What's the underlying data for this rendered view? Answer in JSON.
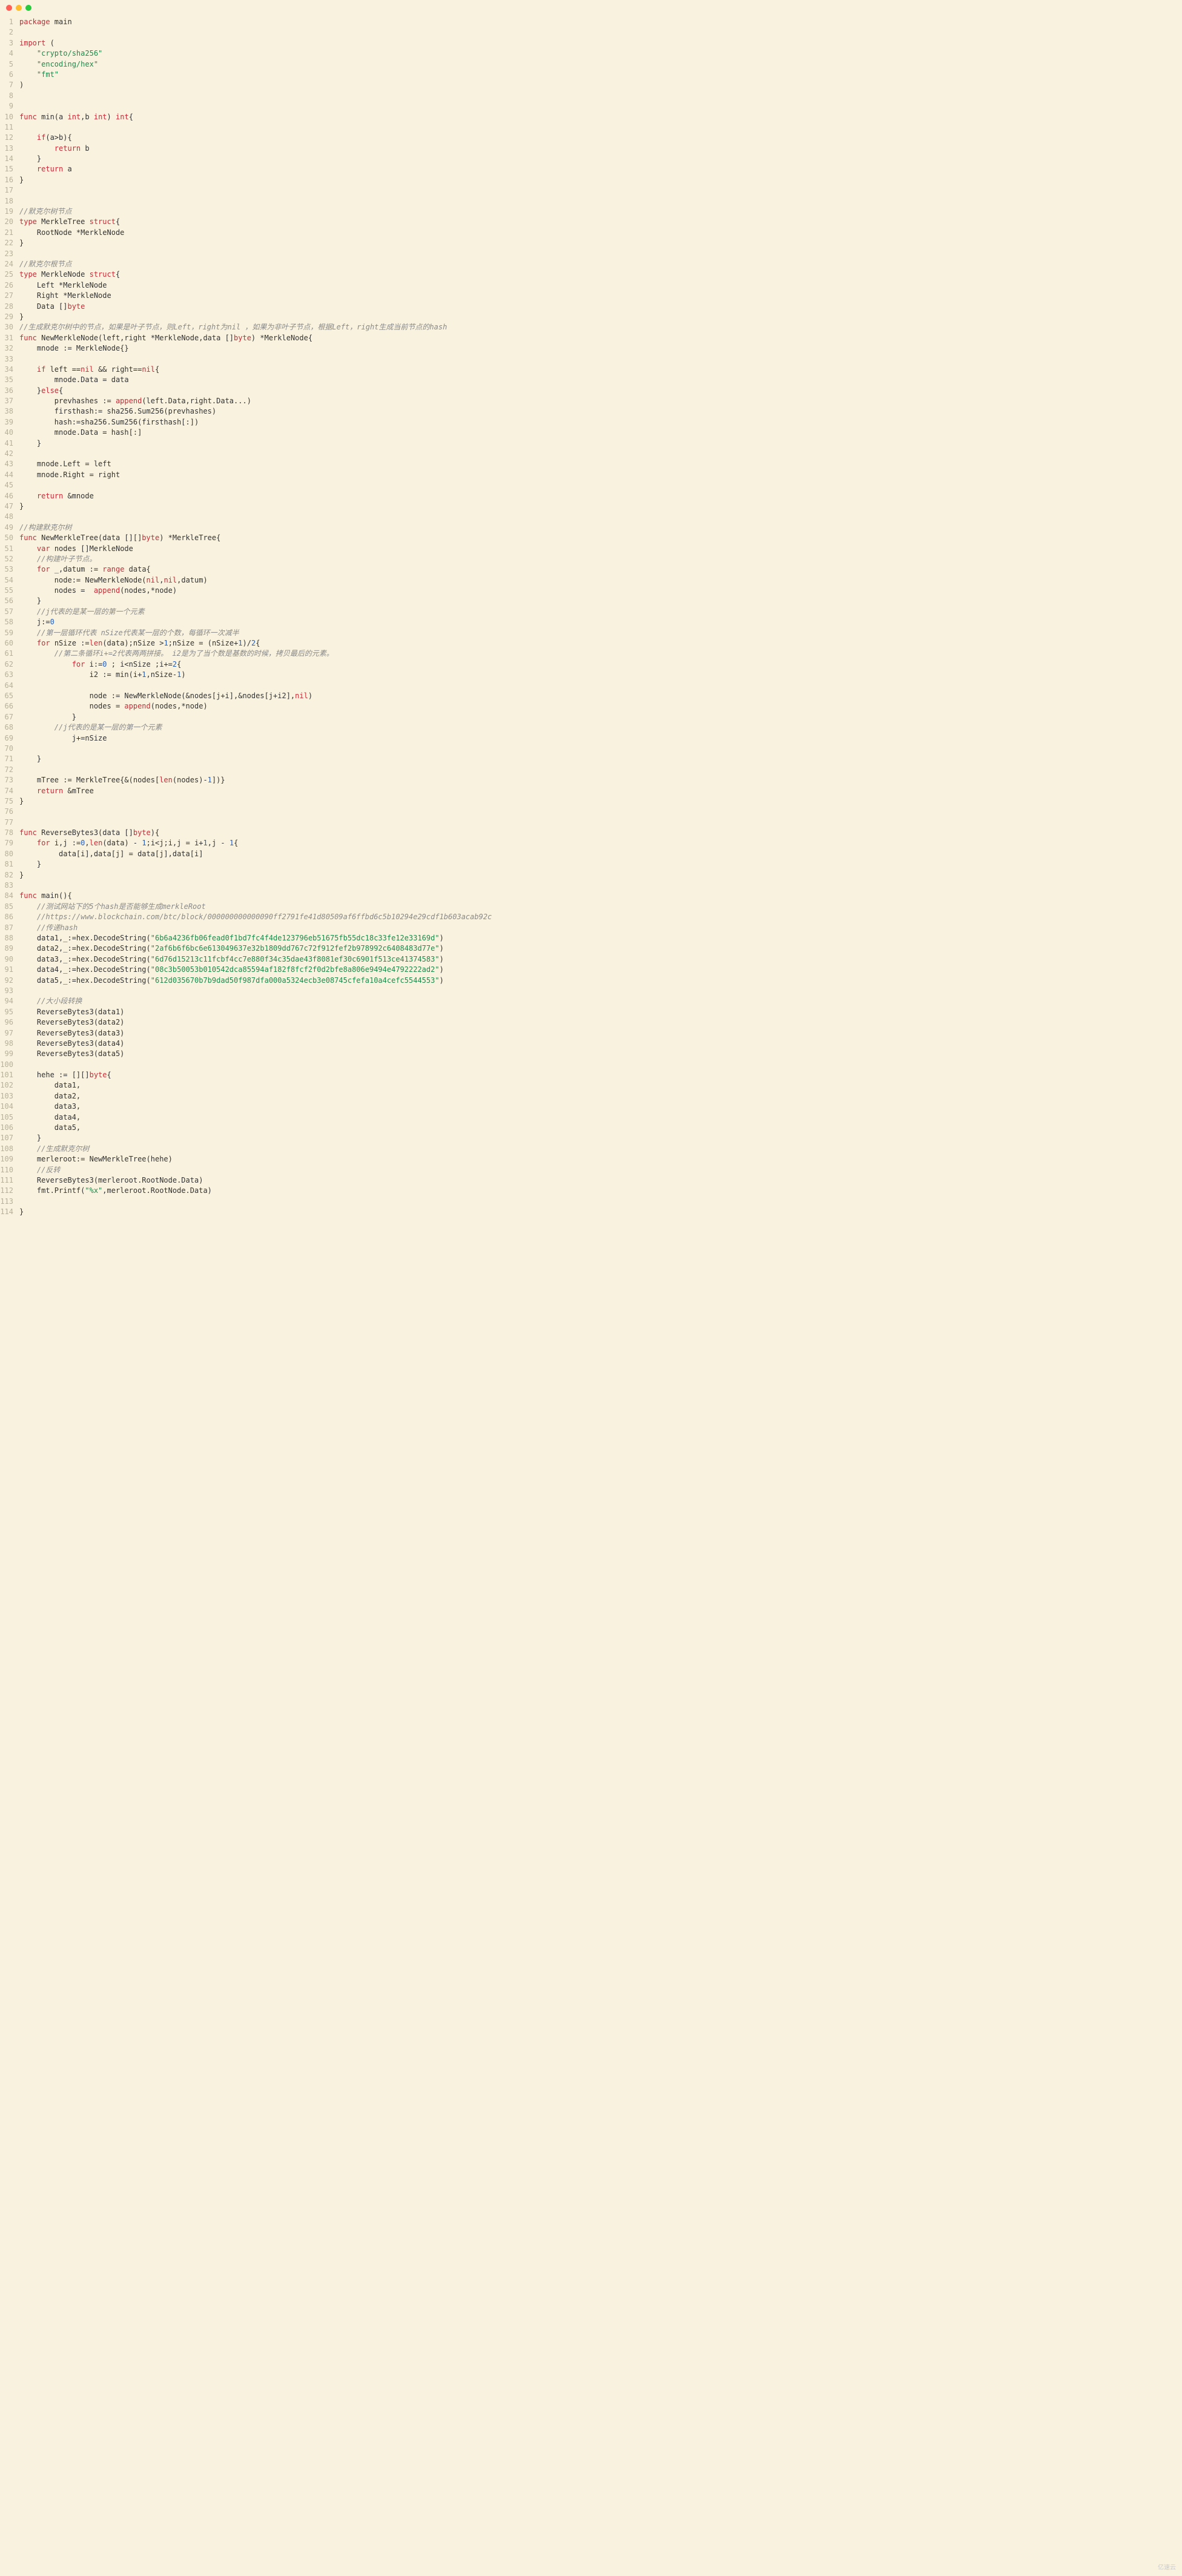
{
  "window": {
    "dots": [
      "red",
      "yellow",
      "green"
    ]
  },
  "watermark": "亿速云",
  "lines": [
    {
      "n": 1,
      "t": [
        [
          "kw",
          "package"
        ],
        [
          "",
          " main"
        ]
      ]
    },
    {
      "n": 2,
      "t": []
    },
    {
      "n": 3,
      "t": [
        [
          "kw",
          "import"
        ],
        [
          "",
          " ("
        ]
      ]
    },
    {
      "n": 4,
      "t": [
        [
          "",
          "    "
        ],
        [
          "str",
          "\"crypto/sha256\""
        ]
      ]
    },
    {
      "n": 5,
      "t": [
        [
          "",
          "    "
        ],
        [
          "str",
          "\"encoding/hex\""
        ]
      ]
    },
    {
      "n": 6,
      "t": [
        [
          "",
          "    "
        ],
        [
          "str",
          "\"fmt\""
        ]
      ]
    },
    {
      "n": 7,
      "t": [
        [
          "",
          ")"
        ]
      ]
    },
    {
      "n": 8,
      "t": []
    },
    {
      "n": 9,
      "t": []
    },
    {
      "n": 10,
      "t": [
        [
          "kw",
          "func"
        ],
        [
          "",
          " min(a "
        ],
        [
          "kw",
          "int"
        ],
        [
          "",
          ",b "
        ],
        [
          "kw",
          "int"
        ],
        [
          "",
          ") "
        ],
        [
          "kw",
          "int"
        ],
        [
          "",
          "{"
        ]
      ]
    },
    {
      "n": 11,
      "t": []
    },
    {
      "n": 12,
      "t": [
        [
          "",
          "    "
        ],
        [
          "kw",
          "if"
        ],
        [
          "",
          "(a>b){"
        ]
      ]
    },
    {
      "n": 13,
      "t": [
        [
          "",
          "        "
        ],
        [
          "kw",
          "return"
        ],
        [
          "",
          " b"
        ]
      ]
    },
    {
      "n": 14,
      "t": [
        [
          "",
          "    }"
        ]
      ]
    },
    {
      "n": 15,
      "t": [
        [
          "",
          "    "
        ],
        [
          "kw",
          "return"
        ],
        [
          "",
          " a"
        ]
      ]
    },
    {
      "n": 16,
      "t": [
        [
          "",
          "}"
        ]
      ]
    },
    {
      "n": 17,
      "t": []
    },
    {
      "n": 18,
      "t": []
    },
    {
      "n": 19,
      "t": [
        [
          "cmt",
          "//默克尔树节点"
        ]
      ]
    },
    {
      "n": 20,
      "t": [
        [
          "kw",
          "type"
        ],
        [
          "",
          " MerkleTree "
        ],
        [
          "kw",
          "struct"
        ],
        [
          "",
          "{"
        ]
      ]
    },
    {
      "n": 21,
      "t": [
        [
          "",
          "    RootNode *MerkleNode"
        ]
      ]
    },
    {
      "n": 22,
      "t": [
        [
          "",
          "}"
        ]
      ]
    },
    {
      "n": 23,
      "t": []
    },
    {
      "n": 24,
      "t": [
        [
          "cmt",
          "//默克尔根节点"
        ]
      ]
    },
    {
      "n": 25,
      "t": [
        [
          "kw",
          "type"
        ],
        [
          "",
          " MerkleNode "
        ],
        [
          "kw",
          "struct"
        ],
        [
          "",
          "{"
        ]
      ]
    },
    {
      "n": 26,
      "t": [
        [
          "",
          "    Left *MerkleNode"
        ]
      ]
    },
    {
      "n": 27,
      "t": [
        [
          "",
          "    Right *MerkleNode"
        ]
      ]
    },
    {
      "n": 28,
      "t": [
        [
          "",
          "    Data []"
        ],
        [
          "kw",
          "byte"
        ]
      ]
    },
    {
      "n": 29,
      "t": [
        [
          "",
          "}"
        ]
      ]
    },
    {
      "n": 30,
      "t": [
        [
          "cmt",
          "//生成默克尔树中的节点，如果是叶子节点，则Left，right为nil ，如果为非叶子节点，根据Left，right生成当前节点的hash"
        ]
      ]
    },
    {
      "n": 31,
      "t": [
        [
          "kw",
          "func"
        ],
        [
          "",
          " NewMerkleNode(left,right *MerkleNode,data []"
        ],
        [
          "kw",
          "byte"
        ],
        [
          "",
          ") *MerkleNode{"
        ]
      ]
    },
    {
      "n": 32,
      "t": [
        [
          "",
          "    mnode := MerkleNode{}"
        ]
      ]
    },
    {
      "n": 33,
      "t": []
    },
    {
      "n": 34,
      "t": [
        [
          "",
          "    "
        ],
        [
          "kw",
          "if"
        ],
        [
          "",
          " left =="
        ],
        [
          "kw",
          "nil"
        ],
        [
          "",
          " && right=="
        ],
        [
          "kw",
          "nil"
        ],
        [
          "",
          "{"
        ]
      ]
    },
    {
      "n": 35,
      "t": [
        [
          "",
          "        mnode.Data = data"
        ]
      ]
    },
    {
      "n": 36,
      "t": [
        [
          "",
          "    }"
        ],
        [
          "kw",
          "else"
        ],
        [
          "",
          "{"
        ]
      ]
    },
    {
      "n": 37,
      "t": [
        [
          "",
          "        prevhashes := "
        ],
        [
          "bltn",
          "append"
        ],
        [
          "",
          "(left.Data,right.Data...)"
        ]
      ]
    },
    {
      "n": 38,
      "t": [
        [
          "",
          "        firsthash:= sha256.Sum256(prevhashes)"
        ]
      ]
    },
    {
      "n": 39,
      "t": [
        [
          "",
          "        hash:=sha256.Sum256(firsthash[:])"
        ]
      ]
    },
    {
      "n": 40,
      "t": [
        [
          "",
          "        mnode.Data = hash[:]"
        ]
      ]
    },
    {
      "n": 41,
      "t": [
        [
          "",
          "    }"
        ]
      ]
    },
    {
      "n": 42,
      "t": []
    },
    {
      "n": 43,
      "t": [
        [
          "",
          "    mnode.Left = left"
        ]
      ]
    },
    {
      "n": 44,
      "t": [
        [
          "",
          "    mnode.Right = right"
        ]
      ]
    },
    {
      "n": 45,
      "t": []
    },
    {
      "n": 46,
      "t": [
        [
          "",
          "    "
        ],
        [
          "kw",
          "return"
        ],
        [
          "",
          " &mnode"
        ]
      ]
    },
    {
      "n": 47,
      "t": [
        [
          "",
          "}"
        ]
      ]
    },
    {
      "n": 48,
      "t": []
    },
    {
      "n": 49,
      "t": [
        [
          "cmt",
          "//构建默克尔树"
        ]
      ]
    },
    {
      "n": 50,
      "t": [
        [
          "kw",
          "func"
        ],
        [
          "",
          " NewMerkleTree(data [][]"
        ],
        [
          "kw",
          "byte"
        ],
        [
          "",
          ") *MerkleTree{"
        ]
      ]
    },
    {
      "n": 51,
      "t": [
        [
          "",
          "    "
        ],
        [
          "kw",
          "var"
        ],
        [
          "",
          " nodes []MerkleNode"
        ]
      ]
    },
    {
      "n": 52,
      "t": [
        [
          "",
          "    "
        ],
        [
          "cmt",
          "//构建叶子节点。"
        ]
      ]
    },
    {
      "n": 53,
      "t": [
        [
          "",
          "    "
        ],
        [
          "kw",
          "for"
        ],
        [
          "",
          " _,datum := "
        ],
        [
          "kw",
          "range"
        ],
        [
          "",
          " data{"
        ]
      ]
    },
    {
      "n": 54,
      "t": [
        [
          "",
          "        node:= NewMerkleNode("
        ],
        [
          "kw",
          "nil"
        ],
        [
          "",
          ","
        ],
        [
          "kw",
          "nil"
        ],
        [
          "",
          ",datum)"
        ]
      ]
    },
    {
      "n": 55,
      "t": [
        [
          "",
          "        nodes =  "
        ],
        [
          "bltn",
          "append"
        ],
        [
          "",
          "(nodes,*node)"
        ]
      ]
    },
    {
      "n": 56,
      "t": [
        [
          "",
          "    }"
        ]
      ]
    },
    {
      "n": 57,
      "t": [
        [
          "",
          "    "
        ],
        [
          "cmt",
          "//j代表的是某一层的第一个元素"
        ]
      ]
    },
    {
      "n": 58,
      "t": [
        [
          "",
          "    j:="
        ],
        [
          "num",
          "0"
        ]
      ]
    },
    {
      "n": 59,
      "t": [
        [
          "",
          "    "
        ],
        [
          "cmt",
          "//第一层循环代表 nSize代表某一层的个数，每循环一次减半"
        ]
      ]
    },
    {
      "n": 60,
      "t": [
        [
          "",
          "    "
        ],
        [
          "kw",
          "for"
        ],
        [
          "",
          " nSize :="
        ],
        [
          "bltn",
          "len"
        ],
        [
          "",
          "(data);nSize >"
        ],
        [
          "num",
          "1"
        ],
        [
          "",
          ";nSize = (nSize+"
        ],
        [
          "num",
          "1"
        ],
        [
          "",
          ")/"
        ],
        [
          "num",
          "2"
        ],
        [
          "",
          "{"
        ]
      ]
    },
    {
      "n": 61,
      "t": [
        [
          "",
          "        "
        ],
        [
          "cmt",
          "//第二条循环i+=2代表两两拼接。 i2是为了当个数是基数的时候，拷贝最后的元素。"
        ]
      ]
    },
    {
      "n": 62,
      "t": [
        [
          "",
          "            "
        ],
        [
          "kw",
          "for"
        ],
        [
          "",
          " i:="
        ],
        [
          "num",
          "0"
        ],
        [
          "",
          " ; i<nSize ;i+="
        ],
        [
          "num",
          "2"
        ],
        [
          "",
          "{"
        ]
      ]
    },
    {
      "n": 63,
      "t": [
        [
          "",
          "                i2 := min(i+"
        ],
        [
          "num",
          "1"
        ],
        [
          "",
          ",nSize-"
        ],
        [
          "num",
          "1"
        ],
        [
          "",
          ")"
        ]
      ]
    },
    {
      "n": 64,
      "t": []
    },
    {
      "n": 65,
      "t": [
        [
          "",
          "                node := NewMerkleNode(&nodes[j+i],&nodes[j+i2],"
        ],
        [
          "kw",
          "nil"
        ],
        [
          "",
          ")"
        ]
      ]
    },
    {
      "n": 66,
      "t": [
        [
          "",
          "                nodes = "
        ],
        [
          "bltn",
          "append"
        ],
        [
          "",
          "(nodes,*node)"
        ]
      ]
    },
    {
      "n": 67,
      "t": [
        [
          "",
          "            }"
        ]
      ]
    },
    {
      "n": 68,
      "t": [
        [
          "",
          "        "
        ],
        [
          "cmt",
          "//j代表的是某一层的第一个元素"
        ]
      ]
    },
    {
      "n": 69,
      "t": [
        [
          "",
          "            j+=nSize"
        ]
      ]
    },
    {
      "n": 70,
      "t": []
    },
    {
      "n": 71,
      "t": [
        [
          "",
          "    }"
        ]
      ]
    },
    {
      "n": 72,
      "t": []
    },
    {
      "n": 73,
      "t": [
        [
          "",
          "    mTree := MerkleTree{&(nodes["
        ],
        [
          "bltn",
          "len"
        ],
        [
          "",
          "(nodes)-"
        ],
        [
          "num",
          "1"
        ],
        [
          "",
          "])}"
        ]
      ]
    },
    {
      "n": 74,
      "t": [
        [
          "",
          "    "
        ],
        [
          "kw",
          "return"
        ],
        [
          "",
          " &mTree"
        ]
      ]
    },
    {
      "n": 75,
      "t": [
        [
          "",
          "}"
        ]
      ]
    },
    {
      "n": 76,
      "t": []
    },
    {
      "n": 77,
      "t": []
    },
    {
      "n": 78,
      "t": [
        [
          "kw",
          "func"
        ],
        [
          "",
          " ReverseBytes3(data []"
        ],
        [
          "kw",
          "byte"
        ],
        [
          "",
          "){"
        ]
      ]
    },
    {
      "n": 79,
      "t": [
        [
          "",
          "    "
        ],
        [
          "kw",
          "for"
        ],
        [
          "",
          " i,j :="
        ],
        [
          "num",
          "0"
        ],
        [
          "",
          ","
        ],
        [
          "bltn",
          "len"
        ],
        [
          "",
          "(data) - "
        ],
        [
          "num",
          "1"
        ],
        [
          "",
          ";i<j;i,j = i+"
        ],
        [
          "num",
          "1"
        ],
        [
          "",
          ",j - "
        ],
        [
          "num",
          "1"
        ],
        [
          "",
          "{"
        ]
      ]
    },
    {
      "n": 80,
      "t": [
        [
          "",
          "         data[i],data[j] = data[j],data[i]"
        ]
      ]
    },
    {
      "n": 81,
      "t": [
        [
          "",
          "    }"
        ]
      ]
    },
    {
      "n": 82,
      "t": [
        [
          "",
          "}"
        ]
      ]
    },
    {
      "n": 83,
      "t": []
    },
    {
      "n": 84,
      "t": [
        [
          "kw",
          "func"
        ],
        [
          "",
          " main(){"
        ]
      ]
    },
    {
      "n": 85,
      "t": [
        [
          "",
          "    "
        ],
        [
          "cmt",
          "//测试网站下的5个hash是否能够生成merkleRoot"
        ]
      ]
    },
    {
      "n": 86,
      "t": [
        [
          "",
          "    "
        ],
        [
          "cmt",
          "//https://www.blockchain.com/btc/block/000000000000090ff2791fe41d80509af6ffbd6c5b10294e29cdf1b603acab92c"
        ]
      ]
    },
    {
      "n": 87,
      "t": [
        [
          "",
          "    "
        ],
        [
          "cmt",
          "//传递hash"
        ]
      ]
    },
    {
      "n": 88,
      "t": [
        [
          "",
          "    data1,_:=hex.DecodeString("
        ],
        [
          "str",
          "\"6b6a4236fb06fead0f1bd7fc4f4de123796eb51675fb55dc18c33fe12e33169d\""
        ],
        [
          "",
          ")"
        ]
      ]
    },
    {
      "n": 89,
      "t": [
        [
          "",
          "    data2,_:=hex.DecodeString("
        ],
        [
          "str",
          "\"2af6b6f6bc6e613049637e32b1809dd767c72f912fef2b978992c6408483d77e\""
        ],
        [
          "",
          ")"
        ]
      ]
    },
    {
      "n": 90,
      "t": [
        [
          "",
          "    data3,_:=hex.DecodeString("
        ],
        [
          "str",
          "\"6d76d15213c11fcbf4cc7e880f34c35dae43f8081ef30c6901f513ce41374583\""
        ],
        [
          "",
          ")"
        ]
      ]
    },
    {
      "n": 91,
      "t": [
        [
          "",
          "    data4,_:=hex.DecodeString("
        ],
        [
          "str",
          "\"08c3b50053b010542dca85594af182f8fcf2f0d2bfe8a806e9494e4792222ad2\""
        ],
        [
          "",
          ")"
        ]
      ]
    },
    {
      "n": 92,
      "t": [
        [
          "",
          "    data5,_:=hex.DecodeString("
        ],
        [
          "str",
          "\"612d035670b7b9dad50f987dfa000a5324ecb3e08745cfefa10a4cefc5544553\""
        ],
        [
          "",
          ")"
        ]
      ]
    },
    {
      "n": 93,
      "t": []
    },
    {
      "n": 94,
      "t": [
        [
          "",
          "    "
        ],
        [
          "cmt",
          "//大小段转换"
        ]
      ]
    },
    {
      "n": 95,
      "t": [
        [
          "",
          "    ReverseBytes3(data1)"
        ]
      ]
    },
    {
      "n": 96,
      "t": [
        [
          "",
          "    ReverseBytes3(data2)"
        ]
      ]
    },
    {
      "n": 97,
      "t": [
        [
          "",
          "    ReverseBytes3(data3)"
        ]
      ]
    },
    {
      "n": 98,
      "t": [
        [
          "",
          "    ReverseBytes3(data4)"
        ]
      ]
    },
    {
      "n": 99,
      "t": [
        [
          "",
          "    ReverseBytes3(data5)"
        ]
      ]
    },
    {
      "n": 100,
      "t": []
    },
    {
      "n": 101,
      "t": [
        [
          "",
          "    hehe := [][]"
        ],
        [
          "kw",
          "byte"
        ],
        [
          "",
          "{"
        ]
      ]
    },
    {
      "n": 102,
      "t": [
        [
          "",
          "        data1,"
        ]
      ]
    },
    {
      "n": 103,
      "t": [
        [
          "",
          "        data2,"
        ]
      ]
    },
    {
      "n": 104,
      "t": [
        [
          "",
          "        data3,"
        ]
      ]
    },
    {
      "n": 105,
      "t": [
        [
          "",
          "        data4,"
        ]
      ]
    },
    {
      "n": 106,
      "t": [
        [
          "",
          "        data5,"
        ]
      ]
    },
    {
      "n": 107,
      "t": [
        [
          "",
          "    }"
        ]
      ]
    },
    {
      "n": 108,
      "t": [
        [
          "",
          "    "
        ],
        [
          "cmt",
          "//生成默克尔树"
        ]
      ]
    },
    {
      "n": 109,
      "t": [
        [
          "",
          "    merleroot:= NewMerkleTree(hehe)"
        ]
      ]
    },
    {
      "n": 110,
      "t": [
        [
          "",
          "    "
        ],
        [
          "cmt",
          "//反转"
        ]
      ]
    },
    {
      "n": 111,
      "t": [
        [
          "",
          "    ReverseBytes3(merleroot.RootNode.Data)"
        ]
      ]
    },
    {
      "n": 112,
      "t": [
        [
          "",
          "    fmt.Printf("
        ],
        [
          "str",
          "\"%x\""
        ],
        [
          "",
          ",merleroot.RootNode.Data)"
        ]
      ]
    },
    {
      "n": 113,
      "t": []
    },
    {
      "n": 114,
      "t": [
        [
          "",
          "}"
        ]
      ]
    }
  ]
}
